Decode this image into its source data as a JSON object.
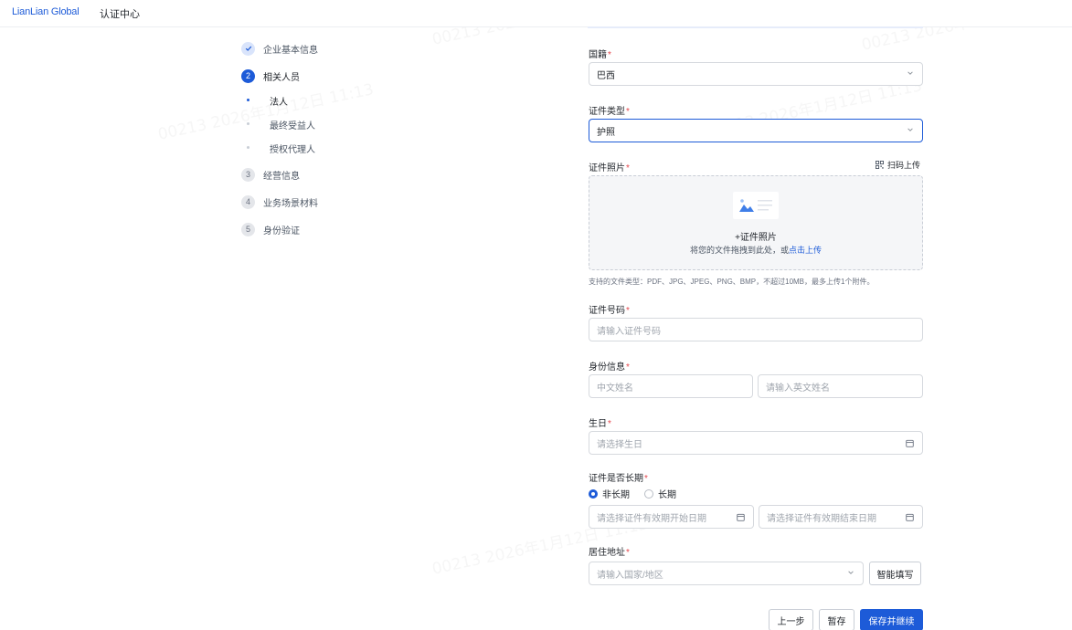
{
  "header": {
    "brand": "LianLian Global",
    "subtitle": "认证中心"
  },
  "steps": [
    {
      "num": "✓",
      "label": "企业基本信息",
      "state": "done"
    },
    {
      "num": "2",
      "label": "相关人员",
      "state": "active"
    },
    {
      "num": "3",
      "label": "经营信息",
      "state": "todo"
    },
    {
      "num": "4",
      "label": "业务场景材料",
      "state": "todo"
    },
    {
      "num": "5",
      "label": "身份验证",
      "state": "todo"
    }
  ],
  "substeps": [
    {
      "label": "法人",
      "active": true
    },
    {
      "label": "最终受益人",
      "active": false
    },
    {
      "label": "授权代理人",
      "active": false
    }
  ],
  "form": {
    "nationality": {
      "label": "国籍",
      "value": "巴西"
    },
    "id_type": {
      "label": "证件类型",
      "value": "护照"
    },
    "id_photo": {
      "label": "证件照片",
      "scan_label": "扫码上传",
      "upload_title": "+证件照片",
      "upload_hint": "将您的文件拖拽到此处，或",
      "upload_link": "点击上传",
      "formats": "支持的文件类型：PDF、JPG、JPEG、PNG、BMP，不超过10MB，最多上传1个附件。"
    },
    "id_number": {
      "label": "证件号码",
      "placeholder": "请输入证件号码"
    },
    "identity": {
      "label": "身份信息",
      "cn_placeholder": "中文姓名",
      "en_placeholder": "请输入英文姓名"
    },
    "birthday": {
      "label": "生日",
      "placeholder": "请选择生日"
    },
    "validity": {
      "label": "证件是否长期",
      "option_no": "非长期",
      "option_yes": "长期",
      "selected": "非长期",
      "start_placeholder": "请选择证件有效期开始日期",
      "end_placeholder": "请选择证件有效期结束日期"
    },
    "address": {
      "label": "居住地址",
      "placeholder": "请输入国家/地区",
      "smart_fill": "智能填写"
    }
  },
  "buttons": {
    "prev": "上一步",
    "save_draft": "暂存",
    "save_continue": "保存并继续"
  },
  "watermark": "00213 2026年1月12日 11:13",
  "colors": {
    "primary": "#1d5bd8",
    "required": "#e5484d"
  }
}
